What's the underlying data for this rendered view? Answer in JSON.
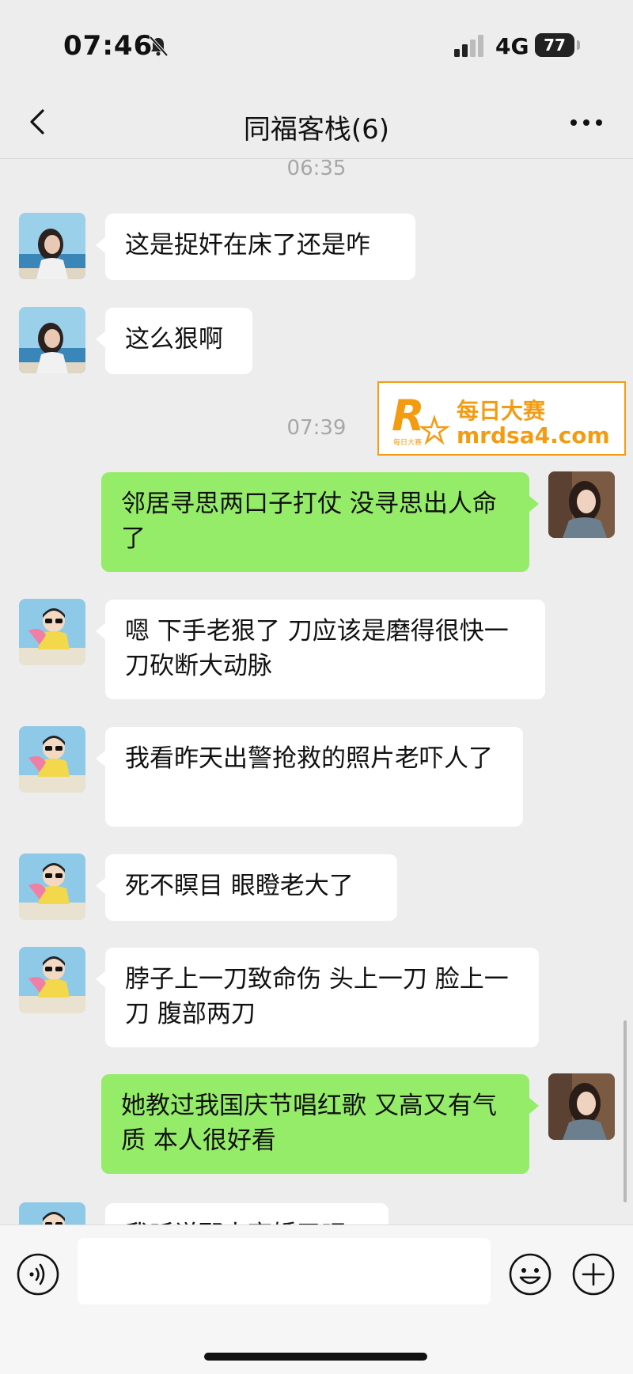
{
  "status_bar": {
    "time": "07:46",
    "network": "4G",
    "battery": "77",
    "battery_level": 0.77
  },
  "header": {
    "title": "同福客栈(6)"
  },
  "messages": [
    {
      "type": "timestamp",
      "text": "06:35"
    },
    {
      "type": "incoming",
      "sender_avatar": "woman-beach-avatar",
      "text": "这是捉奸在床了还是咋"
    },
    {
      "type": "incoming",
      "sender_avatar": "woman-beach-avatar",
      "text": "这么狠啊"
    },
    {
      "type": "timestamp",
      "text": "07:39"
    },
    {
      "type": "outgoing",
      "sender_avatar": "woman-portrait-avatar",
      "text": "邻居寻思两口子打仗 没寻思出人命了"
    },
    {
      "type": "incoming",
      "sender_avatar": "cartoon-girl-avatar",
      "text": "嗯 下手老狠了 刀应该是磨得很快一刀砍断大动脉"
    },
    {
      "type": "incoming",
      "sender_avatar": "cartoon-girl-avatar",
      "text": "我看昨天出警抢救的照片老吓人了"
    },
    {
      "type": "incoming",
      "sender_avatar": "cartoon-girl-avatar",
      "text": "死不瞑目 眼瞪老大了"
    },
    {
      "type": "incoming",
      "sender_avatar": "cartoon-girl-avatar",
      "text": "脖子上一刀致命伤 头上一刀 脸上一刀 腹部两刀"
    },
    {
      "type": "outgoing",
      "sender_avatar": "woman-portrait-avatar",
      "text": "她教过我国庆节唱红歌 又高又有气质 本人很好看"
    },
    {
      "type": "incoming",
      "sender_avatar": "cartoon-girl-avatar",
      "text": "我听说那人离婚了吧"
    }
  ],
  "watermark": {
    "logo_letter": "R",
    "logo_sub": "每日大赛",
    "cn": "每日大赛",
    "url": "mrdsa4.com"
  },
  "input": {
    "value": ""
  },
  "colors": {
    "outgoing_bubble": "#95ec69",
    "incoming_bubble": "#ffffff",
    "background": "#ededed",
    "watermark": "#f39c12"
  }
}
